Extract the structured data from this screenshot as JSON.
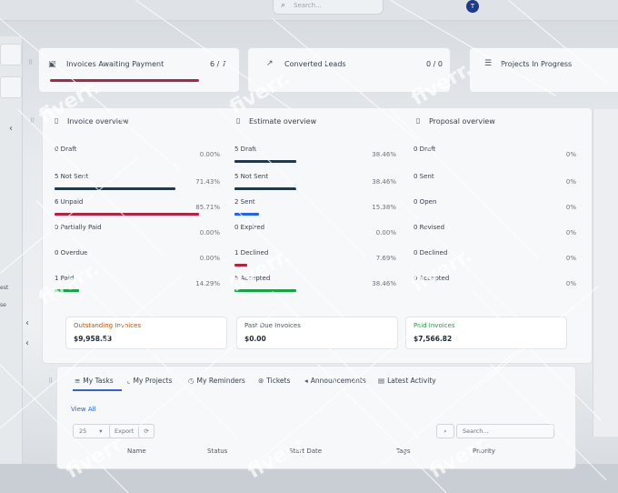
{
  "topbar": {
    "search_placeholder": "Search...",
    "avatar_initial": "T",
    "search_icon": "search-icon"
  },
  "sidebar": {
    "text_1": "est",
    "text_2": "se",
    "chevron": "‹"
  },
  "stats": [
    {
      "label": "Invoices Awaiting Payment",
      "count": "6 / 7",
      "progress": 0.857,
      "color": "#b42342"
    },
    {
      "label": "Converted Leads",
      "count": "0 / 0",
      "progress": 0,
      "color": "#b42342"
    },
    {
      "label": "Projects In Progress",
      "count": "",
      "progress": 0,
      "color": "#b42342"
    }
  ],
  "invoice_overview": {
    "title": "Invoice overview",
    "rows": [
      {
        "label": "0 Draft",
        "pct": "0.00%",
        "fill": 0.0,
        "color": "#6b7280",
        "bar": "#6b7280"
      },
      {
        "label": "5 Not Sent",
        "pct": "71.43%",
        "fill": 0.7143,
        "color": "#6b7280",
        "bar": "#1f3a4f"
      },
      {
        "label": "6 Unpaid",
        "pct": "85.71%",
        "fill": 0.8571,
        "color": "#b42342",
        "bar": "#b42342"
      },
      {
        "label": "0 Partially Paid",
        "pct": "0.00%",
        "fill": 0.0,
        "color": "#6b7280",
        "bar": "#d97706"
      },
      {
        "label": "0 Overdue",
        "pct": "0.00%",
        "fill": 0.0,
        "color": "#6b7280",
        "bar": "#d97706"
      },
      {
        "label": "1 Paid",
        "pct": "14.29%",
        "fill": 0.1429,
        "color": "#16a34a",
        "bar": "#16a34a"
      }
    ]
  },
  "estimate_overview": {
    "title": "Estimate overview",
    "rows": [
      {
        "label": "5 Draft",
        "pct": "38.46%",
        "fill": 0.3846,
        "color": "#6b7280",
        "bar": "#1f3a4f"
      },
      {
        "label": "5 Not Sent",
        "pct": "38.46%",
        "fill": 0.3846,
        "color": "#6b7280",
        "bar": "#1f3a4f"
      },
      {
        "label": "2 Sent",
        "pct": "15.38%",
        "fill": 0.1538,
        "color": "#2563eb",
        "bar": "#2563eb"
      },
      {
        "label": "0 Expired",
        "pct": "0.00%",
        "fill": 0.0,
        "color": "#6b7280",
        "bar": "#d97706"
      },
      {
        "label": "1 Declined",
        "pct": "7.69%",
        "fill": 0.0769,
        "color": "#b42342",
        "bar": "#b42342"
      },
      {
        "label": "5 Accepted",
        "pct": "38.46%",
        "fill": 0.3846,
        "color": "#16a34a",
        "bar": "#16a34a"
      }
    ]
  },
  "proposal_overview": {
    "title": "Proposal overview",
    "rows": [
      {
        "label": "0 Draft",
        "pct": "0%",
        "fill": 0,
        "color": "#6b7280",
        "bar": "#6b7280"
      },
      {
        "label": "0 Sent",
        "pct": "0%",
        "fill": 0,
        "color": "#2563eb",
        "bar": "#2563eb"
      },
      {
        "label": "0 Open",
        "pct": "0%",
        "fill": 0,
        "color": "#6b7280",
        "bar": "#6b7280"
      },
      {
        "label": "0 Revised",
        "pct": "0%",
        "fill": 0,
        "color": "#2563eb",
        "bar": "#2563eb"
      },
      {
        "label": "0 Declined",
        "pct": "0%",
        "fill": 0,
        "color": "#b42342",
        "bar": "#b42342"
      },
      {
        "label": "0 Accepted",
        "pct": "0%",
        "fill": 0,
        "color": "#16a34a",
        "bar": "#16a34a"
      }
    ]
  },
  "summary": [
    {
      "label": "Outstanding Invoices",
      "value": "$9,958.53",
      "color": "#b45309"
    },
    {
      "label": "Past Due Invoices",
      "value": "$0.00",
      "color": "#4b5563"
    },
    {
      "label": "Paid Invoices",
      "value": "$7,566.82",
      "color": "#16a34a"
    }
  ],
  "tabs": [
    {
      "label": "My Tasks",
      "icon": "≡"
    },
    {
      "label": "My Projects",
      "icon": "⌞"
    },
    {
      "label": "My Reminders",
      "icon": "◷"
    },
    {
      "label": "Tickets",
      "icon": "⊛"
    },
    {
      "label": "Announcements",
      "icon": "◂"
    },
    {
      "label": "Latest Activity",
      "icon": "▤"
    }
  ],
  "tasks_panel": {
    "view_all": "View All",
    "page_size": "25",
    "export": "Export",
    "search_placeholder": "Search...",
    "columns": [
      "Name",
      "Status",
      "Start Date",
      "Tags",
      "Priority"
    ]
  },
  "watermark": "fiverr."
}
